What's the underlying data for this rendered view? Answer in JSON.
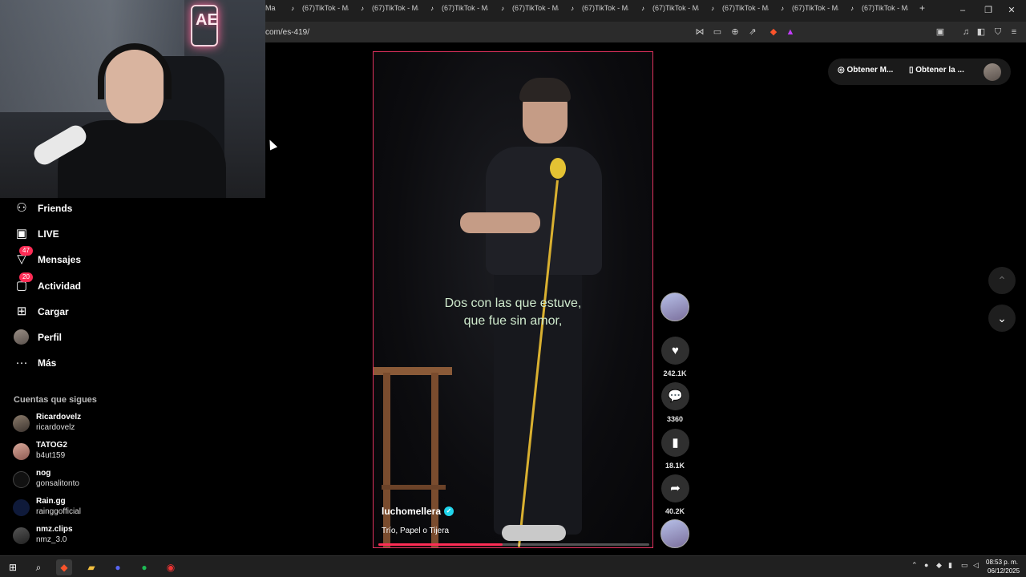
{
  "browser": {
    "tabs": [
      {
        "label": "Ma"
      },
      {
        "label": "(67)TikTok - Ma"
      },
      {
        "label": "(67)TikTok - Ma"
      },
      {
        "label": "(67)TikTok - Ma"
      },
      {
        "label": "(67)TikTok - Ma"
      },
      {
        "label": "(67)TikTok - Ma"
      },
      {
        "label": "(67)TikTok - Ma"
      },
      {
        "label": "(67)TikTok - Ma"
      },
      {
        "label": "(67)TikTok - Ma"
      },
      {
        "label": "(67)TikTok - Ma"
      }
    ],
    "new_tab": "+",
    "url": "com/es-419/",
    "window_controls": {
      "minimize": "–",
      "maximize": "❐",
      "close": "✕"
    }
  },
  "webcam": {
    "neon_sign": "AE"
  },
  "sidebar": {
    "items": [
      {
        "label": "Friends",
        "icon": "friends-icon",
        "glyph": "👥"
      },
      {
        "label": "LIVE",
        "icon": "live-icon",
        "glyph": "📺"
      },
      {
        "label": "Mensajes",
        "icon": "messages-icon",
        "glyph": "▽",
        "badge": "47"
      },
      {
        "label": "Actividad",
        "icon": "activity-icon",
        "glyph": "▢",
        "badge": "20"
      },
      {
        "label": "Cargar",
        "icon": "upload-icon",
        "glyph": "⊞"
      },
      {
        "label": "Perfil",
        "icon": "profile-avatar",
        "glyph": ""
      },
      {
        "label": "Más",
        "icon": "more-icon",
        "glyph": "···"
      }
    ],
    "following_title": "Cuentas que sigues",
    "following": [
      {
        "name": "Ricardovelz",
        "user": "ricardovelz"
      },
      {
        "name": "TATOG2",
        "user": "b4ut159"
      },
      {
        "name": "nog",
        "user": "gonsalitonto"
      },
      {
        "name": "Rain.gg",
        "user": "rainggofficial"
      },
      {
        "name": "nmz.clips",
        "user": "nmz_3.0"
      }
    ]
  },
  "video": {
    "subtitle_line1": "Dos con las que estuve,",
    "subtitle_line2": "que fue sin amor,",
    "author": "luchomellera",
    "description": "Trío, Papel o Tijera",
    "progress": 0.46
  },
  "actions": {
    "likes": "242.1K",
    "comments": "3360",
    "saves": "18.1K",
    "shares": "40.2K"
  },
  "topright": {
    "get_coins": "Obtener M...",
    "get_app": "Obtener la ..."
  },
  "taskbar": {
    "time": "08:53 p. m.",
    "date": "06/12/2025"
  },
  "colors": {
    "accent": "#fe2c55",
    "verified": "#20d5ec",
    "subtitle": "#cfeacd"
  }
}
